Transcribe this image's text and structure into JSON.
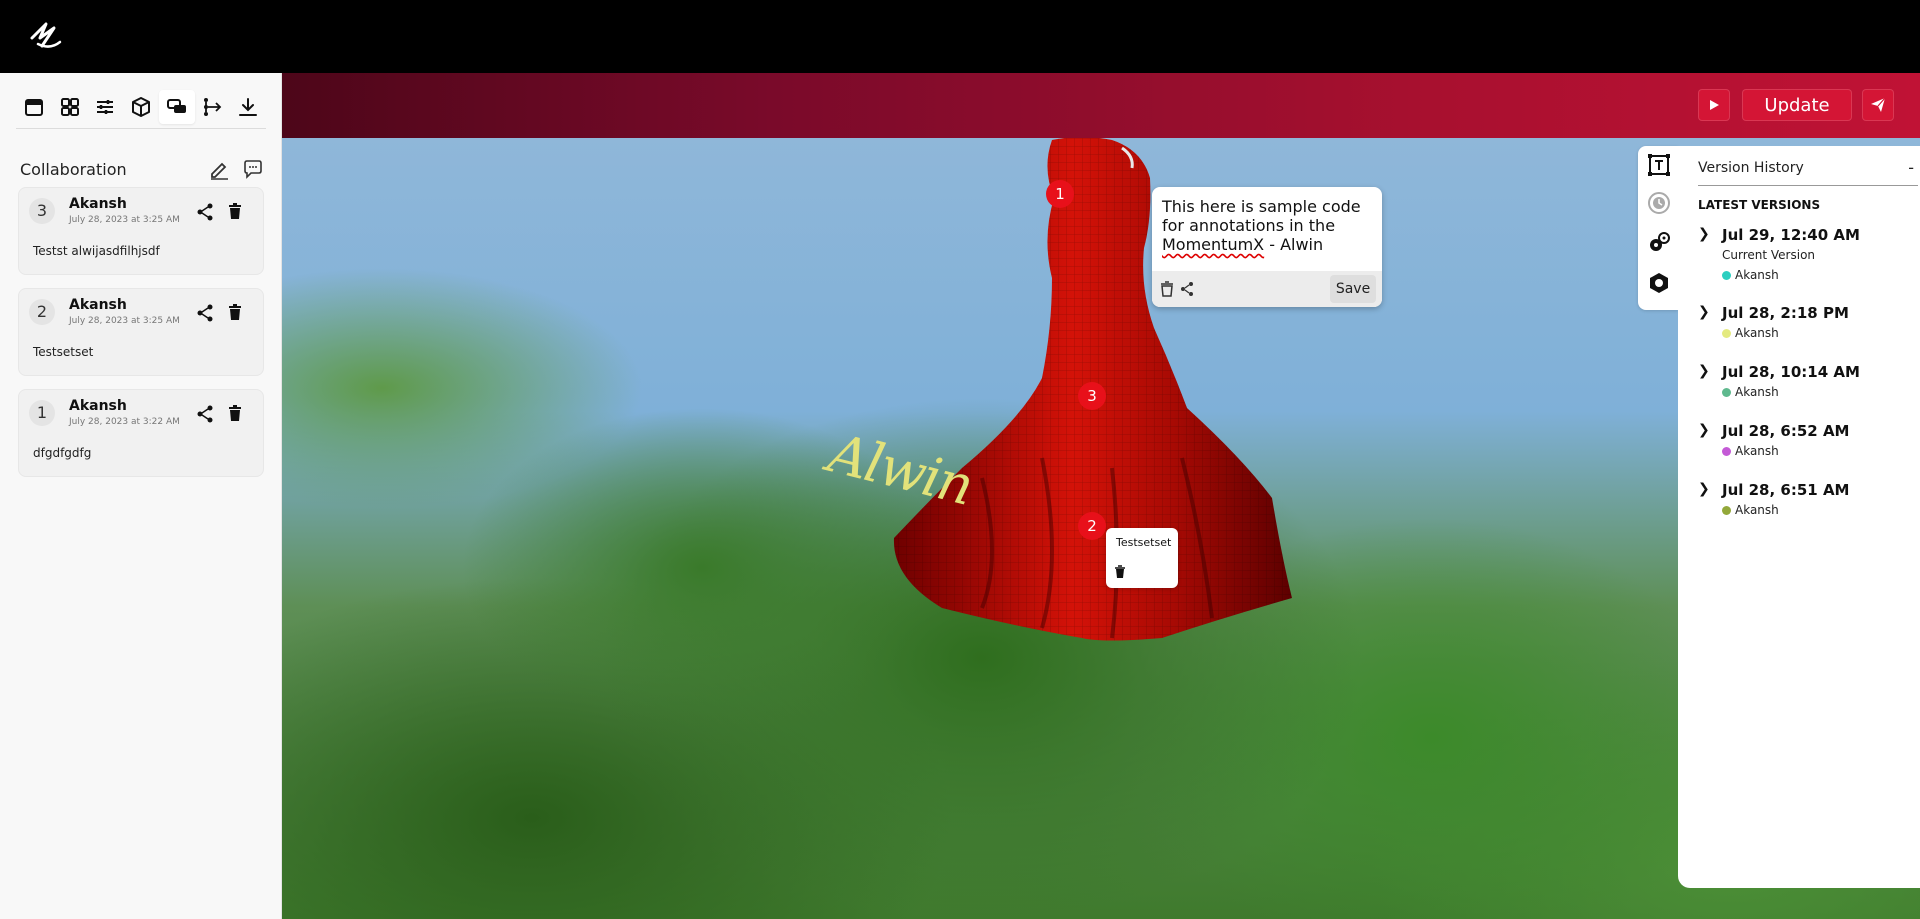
{
  "toolbar": {
    "tools": [
      "sidebar-panel",
      "grid",
      "adjustments",
      "cube",
      "comments",
      "tree",
      "download"
    ]
  },
  "collaboration": {
    "title": "Collaboration",
    "cards": [
      {
        "num": "3",
        "name": "Akansh",
        "date": "July 28, 2023 at 3:25 AM",
        "body": "Testst alwijasdfilhjsdf"
      },
      {
        "num": "2",
        "name": "Akansh",
        "date": "July 28, 2023 at 3:25 AM",
        "body": "Testsetset"
      },
      {
        "num": "1",
        "name": "Akansh",
        "date": "July 28, 2023 at 3:22 AM",
        "body": "dfgdfgdfg"
      }
    ]
  },
  "header": {
    "update_label": "Update"
  },
  "viewport": {
    "markers": [
      "1",
      "3",
      "2"
    ],
    "signature": "Alwin",
    "annotation_edit": {
      "text_line1": "This here is sample code",
      "text_line2": "for annotations in the",
      "text_line3_a": "MomentumX",
      "text_line3_b": " - Alwin",
      "save_label": "Save"
    },
    "annotation_small": {
      "text": "Testsetset"
    }
  },
  "version_history": {
    "title": "Version History",
    "collapse": "-",
    "latest_label": "LATEST VERSIONS",
    "versions": [
      {
        "time": "Jul 29, 12:40 AM",
        "sub": "Current Version",
        "author": "Akansh",
        "color": "#2ccfc0"
      },
      {
        "time": "Jul 28, 2:18 PM",
        "sub": "",
        "author": "Akansh",
        "color": "#e4ea80"
      },
      {
        "time": "Jul 28, 10:14 AM",
        "sub": "",
        "author": "Akansh",
        "color": "#5fb98e"
      },
      {
        "time": "Jul 28, 6:52 AM",
        "sub": "",
        "author": "Akansh",
        "color": "#c45ad6"
      },
      {
        "time": "Jul 28, 6:51 AM",
        "sub": "",
        "author": "Akansh",
        "color": "#93a83a"
      }
    ]
  },
  "colors": {
    "accent": "#d41535",
    "marker": "#e8101a"
  }
}
